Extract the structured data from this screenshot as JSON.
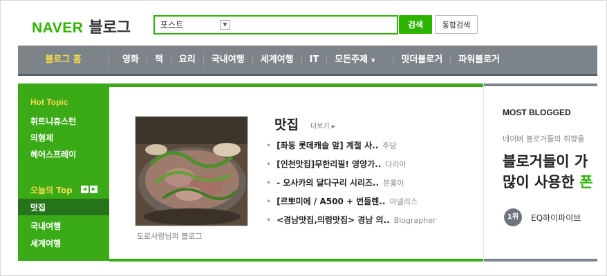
{
  "header": {
    "logo_naver": "NAVER",
    "logo_blog": "블로그",
    "search_scope": "포스트",
    "search_button": "검색",
    "total_search_button": "통합검색",
    "colors": {
      "brand": "#2db400"
    }
  },
  "nav": {
    "home": "블로그 홈",
    "items": [
      "영화",
      "책",
      "요리",
      "국내여행",
      "세계여행",
      "IT",
      "모든주제"
    ],
    "right_items": [
      "밋더블로거",
      "파워블로거"
    ]
  },
  "sidebar": {
    "hot_topic_title": "Hot Topic",
    "hot_links": [
      "휘트니휴스턴",
      "의형제",
      "헤어스프레이"
    ],
    "today_top_title": "오늘의 Top",
    "today_links": [
      "맛집",
      "국내여행",
      "세계여행"
    ]
  },
  "main": {
    "topic_title": "맛집",
    "more_label": "더보기",
    "thumbnail_caption": "도로사랑님의 블로그",
    "posts": [
      {
        "title": "[좌동 롯데캐슬 앞] 계절 사..",
        "author": "주당"
      },
      {
        "title": "[인천맛집]무한리필! 영양가..",
        "author": "다리아"
      },
      {
        "title": "- 오사카의 달다구리 시리즈..",
        "author": "분홍이"
      },
      {
        "title": "[르뽀미에 / A500 + 번들렌..",
        "author": "아넬리스"
      },
      {
        "title": "<경남맛집,의령맛집> 경남 의..",
        "author": "Blographer"
      }
    ]
  },
  "right": {
    "title": "MOST BLOGGED",
    "subtitle": "네이버 블로거들의 취향을",
    "headline_line1": "블로거들이 가",
    "headline_line2_a": "많이 사용한 ",
    "headline_line2_b": "폰",
    "rank_label": "1위",
    "rank_name": "EQ하이파이브"
  }
}
